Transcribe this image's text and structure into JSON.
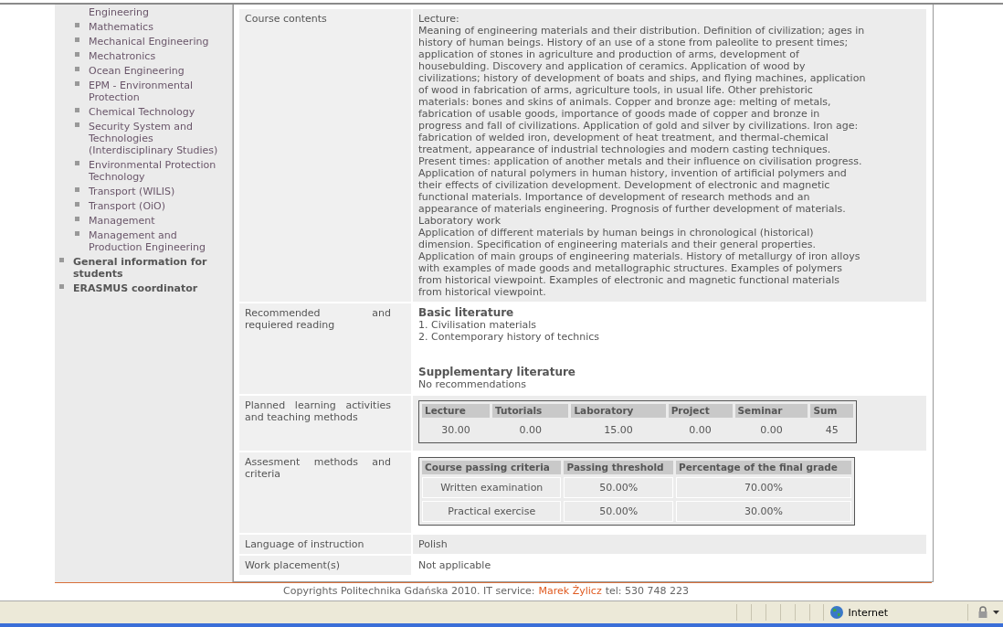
{
  "sidebar": {
    "items": [
      {
        "kind": "fragment",
        "label": "Engineering"
      },
      {
        "kind": "sub",
        "label": "Mathematics"
      },
      {
        "kind": "sub",
        "label": "Mechanical Engineering"
      },
      {
        "kind": "sub",
        "label": "Mechatronics"
      },
      {
        "kind": "sub",
        "label": "Ocean Engineering"
      },
      {
        "kind": "sub",
        "label": "EPM - Environmental Protection"
      },
      {
        "kind": "sub",
        "label": "Chemical Technology"
      },
      {
        "kind": "sub",
        "label": "Security System and Technologies (Interdisciplinary Studies)"
      },
      {
        "kind": "sub",
        "label": "Environmental Protection Technology"
      },
      {
        "kind": "sub",
        "label": "Transport (WILIS)"
      },
      {
        "kind": "sub",
        "label": "Transport (OiO)"
      },
      {
        "kind": "sub",
        "label": "Management"
      },
      {
        "kind": "sub",
        "label": "Management and Production Engineering"
      },
      {
        "kind": "main",
        "label": "General information for students"
      },
      {
        "kind": "main",
        "label": "ERASMUS coordinator"
      }
    ]
  },
  "details": [
    {
      "kind": "paragraphs",
      "label": "Course contents",
      "paragraphs": [
        "Lecture:",
        "Meaning of  engineering materials and their distribution. Definition of civilization; ages  in history of human  beings. History of an use of a stone from paleolite to present times; application of stones in agriculture and production of arms, development of housebulding. Discovery and application of ceramics. Application of wood by civilizations; history of development of boats and ships, and flying machines, application of wood in fabrication of arms, agriculture tools, in usual life. Other prehistoric materials: bones and skins of animals. Copper and bronze age: melting of metals, fabrication of usable goods, importance of goods made of copper and bronze in progress and fall of civilizations. Application of gold and silver by civilizations. Iron age: fabrication of welded iron, development of heat treatment, and thermal-chemical treatment, appearance of industrial technologies and modern casting techniques. Present times: application of another metals and their influence on civilisation progress. Application of natural polymers in human history, invention of artificial polymers and their effects of civilization development. Development of electronic and magnetic functional materials. Importance of development of research methods and an appearance of materials engineering. Prognosis of further development of materials.",
        "Laboratory work",
        "Application of different materials by human beings in chronological (historical) dimension. Specification of engineering materials and their general properties. Application of main groups of engineering materials. History of metallurgy of iron alloys with examples of made goods and metallographic structures. Examples of polymers from  historical viewpoint. Examples of electronic and  magnetic functional materials from historical viewpoint."
      ]
    },
    {
      "kind": "literature",
      "label": "Recommended and requiered reading",
      "basic_heading": "Basic literature",
      "basic": [
        "1. Civilisation materials",
        "2. Contemporary history of technics"
      ],
      "supplementary_heading": "Supplementary literature",
      "supplementary": [
        "No recommendations"
      ]
    },
    {
      "kind": "table",
      "label": "Planned learning activities and teaching methods",
      "columns": [
        "Lecture",
        "Tutorials",
        "Laboratory",
        "Project",
        "Seminar",
        "Sum"
      ],
      "rows": [
        [
          "30.00",
          "0.00",
          "15.00",
          "0.00",
          "0.00",
          "45"
        ]
      ]
    },
    {
      "kind": "table",
      "label": "Assesment methods and criteria",
      "columns": [
        "Course passing criteria",
        "Passing threshold",
        "Percentage of the final grade"
      ],
      "rows": [
        [
          "Written examination",
          "50.00%",
          "70.00%"
        ],
        [
          "Practical exercise",
          "50.00%",
          "30.00%"
        ]
      ]
    },
    {
      "kind": "text",
      "label": "Language of instruction",
      "value": "Polish"
    },
    {
      "kind": "text",
      "label": "Work placement(s)",
      "value": "Not applicable"
    }
  ],
  "footer": {
    "text": "Copyrights Politechnika Gdańska 2010. IT service:",
    "link": "Marek Żylicz",
    "phone": "tel: 530 748 223"
  },
  "status_bar": {
    "zone": "Internet"
  }
}
